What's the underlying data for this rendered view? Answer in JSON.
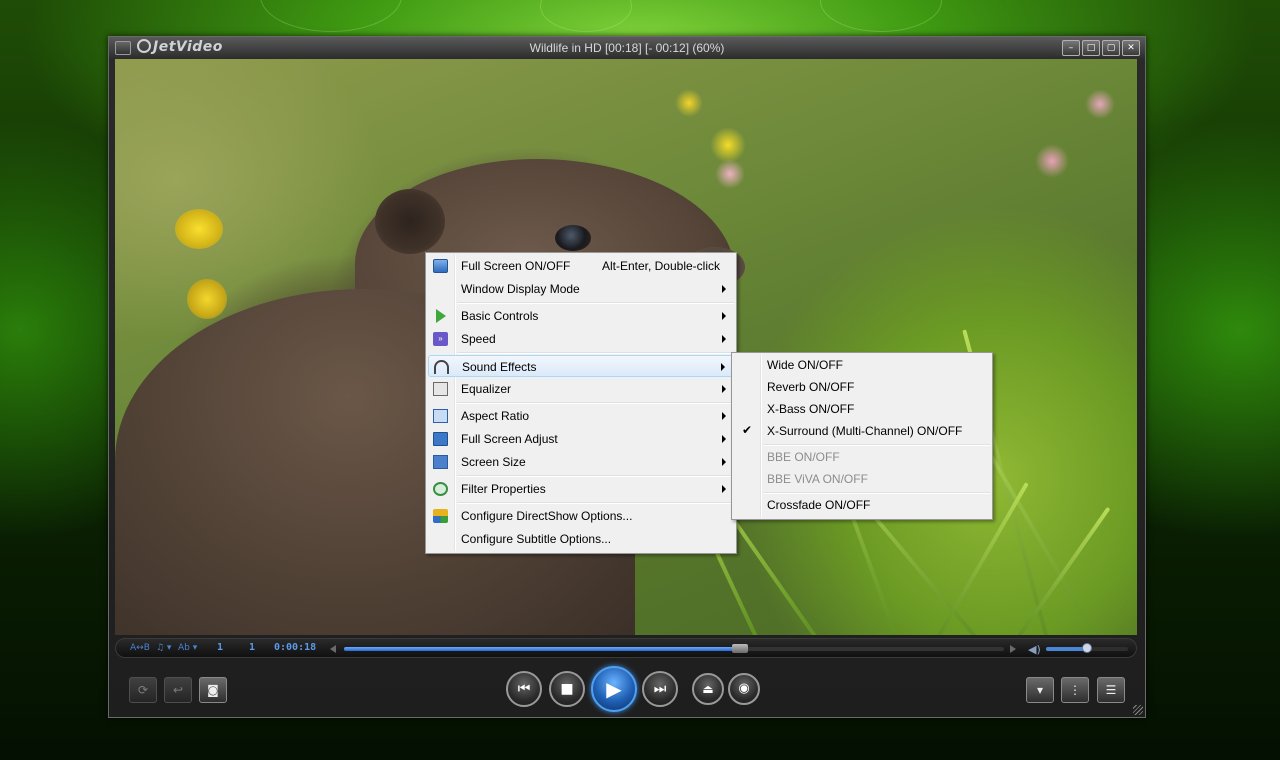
{
  "window": {
    "app_name": "JetVideo",
    "title": "Wildlife in HD [00:18] [- 00:12] (60%)",
    "buttons": {
      "minimize": "–",
      "restore": "□",
      "maximize": "▢",
      "close": "✕"
    }
  },
  "context_menu": {
    "items": [
      {
        "label": "Full Screen ON/OFF",
        "shortcut": "Alt-Enter, Double-click",
        "icon": "fullscreen-icon"
      },
      {
        "label": "Window Display Mode",
        "submenu": true
      },
      {
        "label": "Basic Controls",
        "submenu": true,
        "icon": "play-green-icon"
      },
      {
        "label": "Speed",
        "submenu": true,
        "icon": "speed-icon"
      },
      {
        "label": "Sound Effects",
        "submenu": true,
        "highlighted": true,
        "icon": "headphones-icon"
      },
      {
        "label": "Equalizer",
        "submenu": true,
        "icon": "equalizer-icon"
      },
      {
        "label": "Aspect Ratio",
        "submenu": true,
        "icon": "aspect-ratio-icon"
      },
      {
        "label": "Full Screen Adjust",
        "submenu": true,
        "icon": "fullscreen-adjust-icon"
      },
      {
        "label": "Screen Size",
        "submenu": true,
        "icon": "screen-size-icon"
      },
      {
        "label": "Filter Properties",
        "submenu": true,
        "icon": "filter-icon"
      },
      {
        "label": "Configure DirectShow Options...",
        "icon": "directshow-icon"
      },
      {
        "label": "Configure Subtitle Options..."
      }
    ]
  },
  "sound_effects_submenu": {
    "items": [
      {
        "label": "Wide ON/OFF",
        "checked": false,
        "enabled": true
      },
      {
        "label": "Reverb ON/OFF",
        "checked": false,
        "enabled": true
      },
      {
        "label": "X-Bass ON/OFF",
        "checked": false,
        "enabled": true
      },
      {
        "label": "X-Surround (Multi-Channel) ON/OFF",
        "checked": true,
        "enabled": true
      },
      {
        "label": "BBE ON/OFF",
        "checked": false,
        "enabled": false
      },
      {
        "label": "BBE ViVA ON/OFF",
        "checked": false,
        "enabled": false
      },
      {
        "label": "Crossfade ON/OFF",
        "checked": false,
        "enabled": true
      }
    ],
    "check_glyph": "✔"
  },
  "seekbar": {
    "ab_repeat": "A↔B",
    "audio_track": "♫ ▾",
    "subtitle": "Ab ▾",
    "chapter": "1",
    "title_num": "1",
    "time": "0:00:18",
    "progress": 0.6,
    "volume": 0.5
  },
  "controls": {
    "left": {
      "repeat": "⟳",
      "back": "↩",
      "snapshot": "◙"
    },
    "prev": "⏮",
    "stop": "■",
    "play": "▶",
    "next": "⏭",
    "open": "⏏",
    "record": "◉",
    "right": {
      "dropdown": "▾",
      "info": "⋮",
      "playlist": "☰"
    }
  },
  "colors": {
    "accent_blue": "#4a86d8",
    "menu_bg": "#f0f0f0",
    "menu_highlight_border": "#a8d8f8"
  }
}
